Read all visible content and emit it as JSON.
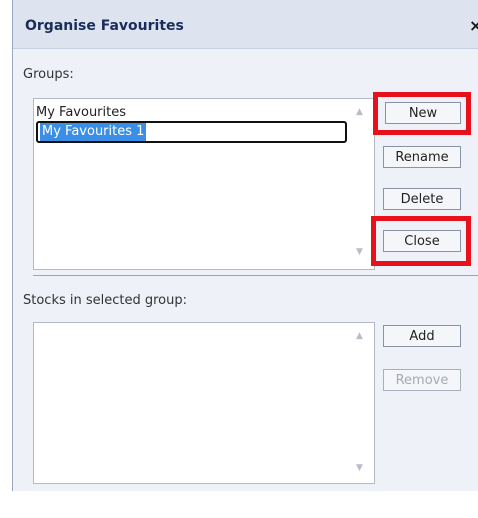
{
  "dialog": {
    "title": "Organise Favourites",
    "close_glyph": "×"
  },
  "groups": {
    "label": "Groups:",
    "items": [
      "My Favourites",
      "My Favourites 1"
    ],
    "selected": "My Favourites 1"
  },
  "buttons": {
    "new": "New",
    "rename": "Rename",
    "delete": "Delete",
    "close": "Close",
    "add": "Add",
    "remove": "Remove"
  },
  "stocks": {
    "label": "Stocks in selected group:",
    "items": []
  },
  "icons": {
    "scroll_up": "▲",
    "scroll_down": "▼"
  },
  "colors": {
    "highlight_annotation": "#e8101a",
    "selection": "#3a8ee6",
    "title_text": "#1a2d5a"
  }
}
